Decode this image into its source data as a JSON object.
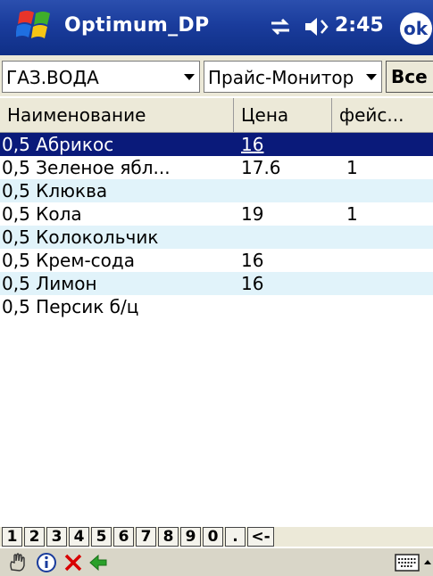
{
  "titlebar": {
    "app_title": "Optimum_DP",
    "time": "2:45",
    "ok_label": "ok"
  },
  "filters": {
    "category": "ГАЗ.ВОДА",
    "pricelist": "Прайс-Монитор",
    "all_button": "Все"
  },
  "table": {
    "columns": [
      "Наименование",
      "Цена",
      "фейс..."
    ],
    "rows": [
      {
        "name": "0,5 Абрикос",
        "price": "16",
        "face": "",
        "selected": true
      },
      {
        "name": "0,5 Зеленое ябл...",
        "price": "17.6",
        "face": "1"
      },
      {
        "name": "0,5 Клюква",
        "price": "",
        "face": ""
      },
      {
        "name": "0,5 Кола",
        "price": "19",
        "face": "1"
      },
      {
        "name": "0,5 Колокольчик",
        "price": "",
        "face": ""
      },
      {
        "name": "0,5 Крем-сода",
        "price": "16",
        "face": ""
      },
      {
        "name": "0,5 Лимон",
        "price": "16",
        "face": ""
      },
      {
        "name": "0,5 Персик б/ц",
        "price": "",
        "face": ""
      }
    ]
  },
  "keypad": {
    "keys": [
      "1",
      "2",
      "3",
      "4",
      "5",
      "6",
      "7",
      "8",
      "9",
      "0",
      ".",
      "<-"
    ]
  },
  "toolbar": {
    "icons": [
      "hand-icon",
      "info-icon",
      "delete-icon",
      "back-arrow-icon",
      "keyboard-icon"
    ]
  },
  "colors": {
    "titlebar": "#1a3c9c",
    "selection": "#0a1a7a",
    "alt_row": "#e1f3fa",
    "delete": "#d80000",
    "back_arrow": "#2aa02a"
  }
}
